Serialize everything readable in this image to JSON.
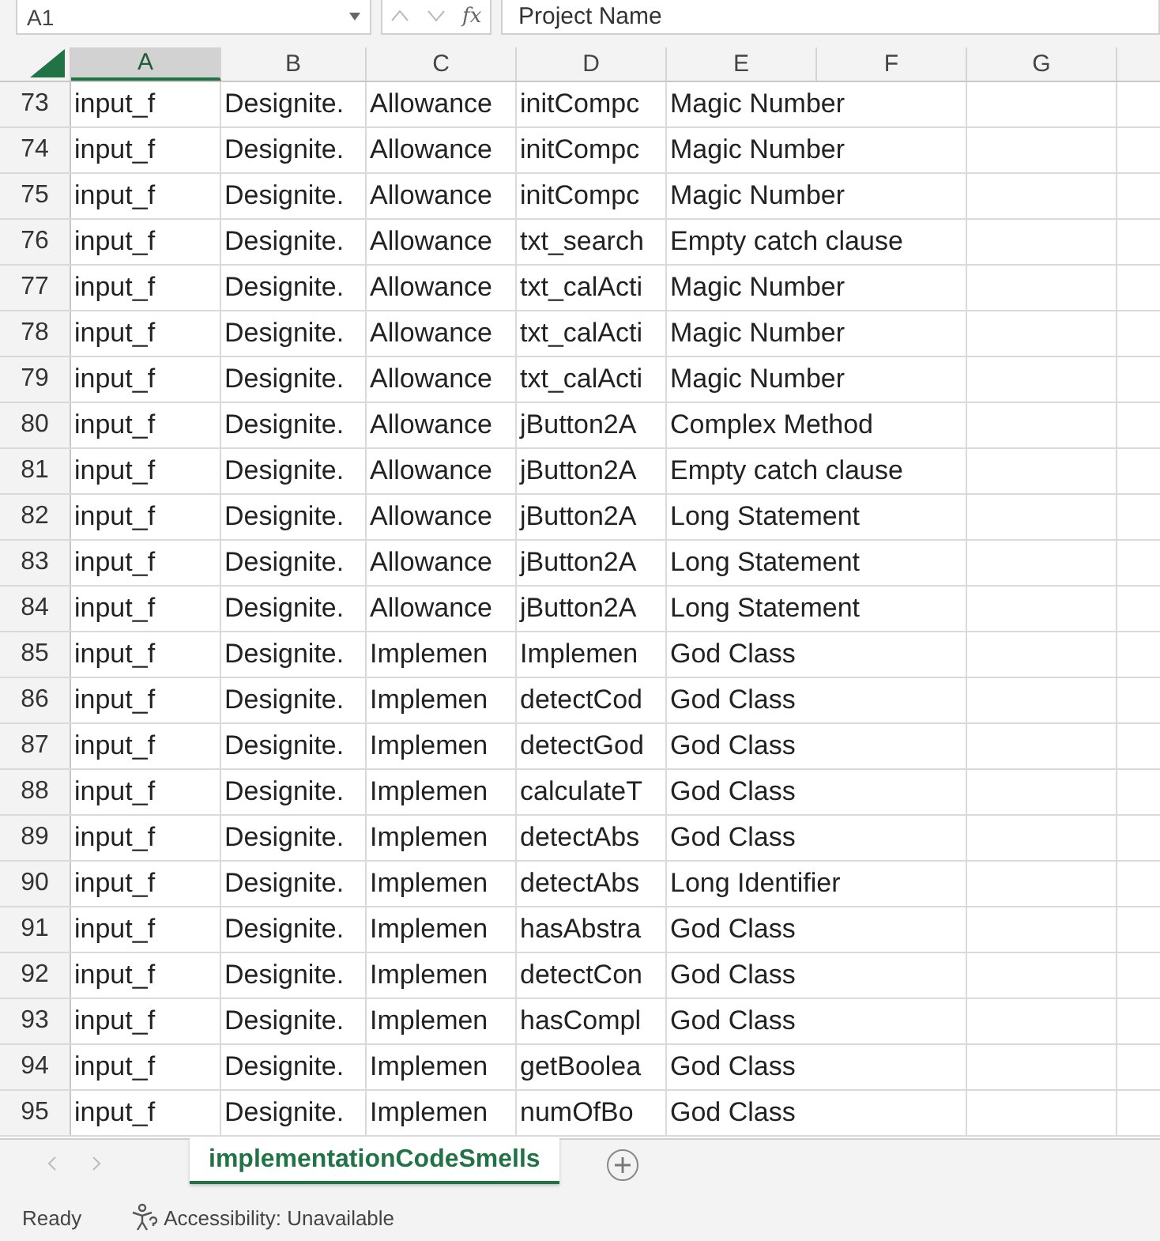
{
  "formula_bar": {
    "name_box": "A1",
    "fx": "fx",
    "value": "Project Name"
  },
  "columns": [
    {
      "label": "A",
      "selected": true
    },
    {
      "label": "B",
      "selected": false
    },
    {
      "label": "C",
      "selected": false
    },
    {
      "label": "D",
      "selected": false
    },
    {
      "label": "E",
      "selected": false
    },
    {
      "label": "F",
      "selected": false
    },
    {
      "label": "G",
      "selected": false
    }
  ],
  "rows": [
    {
      "number": "73",
      "cells": [
        "input_f",
        "Designite.",
        "Allowance",
        "initCompc",
        "Magic Number"
      ]
    },
    {
      "number": "74",
      "cells": [
        "input_f",
        "Designite.",
        "Allowance",
        "initCompc",
        "Magic Number"
      ]
    },
    {
      "number": "75",
      "cells": [
        "input_f",
        "Designite.",
        "Allowance",
        "initCompc",
        "Magic Number"
      ]
    },
    {
      "number": "76",
      "cells": [
        "input_f",
        "Designite.",
        "Allowance",
        "txt_search",
        "Empty catch clause"
      ]
    },
    {
      "number": "77",
      "cells": [
        "input_f",
        "Designite.",
        "Allowance",
        "txt_calActi",
        "Magic Number"
      ]
    },
    {
      "number": "78",
      "cells": [
        "input_f",
        "Designite.",
        "Allowance",
        "txt_calActi",
        "Magic Number"
      ]
    },
    {
      "number": "79",
      "cells": [
        "input_f",
        "Designite.",
        "Allowance",
        "txt_calActi",
        "Magic Number"
      ]
    },
    {
      "number": "80",
      "cells": [
        "input_f",
        "Designite.",
        "Allowance",
        "jButton2A",
        "Complex Method"
      ]
    },
    {
      "number": "81",
      "cells": [
        "input_f",
        "Designite.",
        "Allowance",
        "jButton2A",
        "Empty catch clause"
      ]
    },
    {
      "number": "82",
      "cells": [
        "input_f",
        "Designite.",
        "Allowance",
        "jButton2A",
        "Long Statement"
      ]
    },
    {
      "number": "83",
      "cells": [
        "input_f",
        "Designite.",
        "Allowance",
        "jButton2A",
        "Long Statement"
      ]
    },
    {
      "number": "84",
      "cells": [
        "input_f",
        "Designite.",
        "Allowance",
        "jButton2A",
        "Long Statement"
      ]
    },
    {
      "number": "85",
      "cells": [
        "input_f",
        "Designite.",
        "Implemen",
        "Implemen",
        "God Class"
      ]
    },
    {
      "number": "86",
      "cells": [
        "input_f",
        "Designite.",
        "Implemen",
        "detectCod",
        "God Class"
      ]
    },
    {
      "number": "87",
      "cells": [
        "input_f",
        "Designite.",
        "Implemen",
        "detectGod",
        "God Class"
      ]
    },
    {
      "number": "88",
      "cells": [
        "input_f",
        "Designite.",
        "Implemen",
        "calculateT",
        "God Class"
      ]
    },
    {
      "number": "89",
      "cells": [
        "input_f",
        "Designite.",
        "Implemen",
        "detectAbs",
        "God Class"
      ]
    },
    {
      "number": "90",
      "cells": [
        "input_f",
        "Designite.",
        "Implemen",
        "detectAbs",
        "Long Identifier"
      ]
    },
    {
      "number": "91",
      "cells": [
        "input_f",
        "Designite.",
        "Implemen",
        "hasAbstra",
        "God Class"
      ]
    },
    {
      "number": "92",
      "cells": [
        "input_f",
        "Designite.",
        "Implemen",
        "detectCon",
        "God Class"
      ]
    },
    {
      "number": "93",
      "cells": [
        "input_f",
        "Designite.",
        "Implemen",
        "hasCompl",
        "God Class"
      ]
    },
    {
      "number": "94",
      "cells": [
        "input_f",
        "Designite.",
        "Implemen",
        "getBoolea",
        "God Class"
      ]
    },
    {
      "number": "95",
      "cells": [
        "input_f",
        "Designite.",
        "Implemen",
        "numOfBo",
        "God Class"
      ]
    }
  ],
  "sheet_tabs": [
    {
      "label": "implementationCodeSmells",
      "selected": true
    }
  ],
  "status_bar": {
    "status": "Ready",
    "accessibility": "Accessibility: Unavailable"
  }
}
